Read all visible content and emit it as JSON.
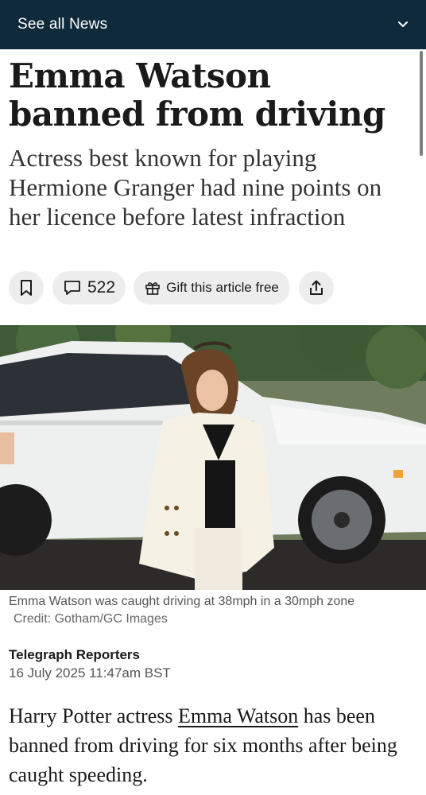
{
  "topbar": {
    "label": "See all News",
    "chevron_icon": "chevron-down-icon"
  },
  "article": {
    "headline": "Emma Watson banned from driving",
    "standfirst": "Actress best known for playing Hermione Granger had nine points on her licence before latest infraction",
    "actions": {
      "bookmark_icon": "bookmark-icon",
      "comment_count": "522",
      "gift_label": "Gift this article free",
      "share_icon": "share-icon"
    },
    "image": {
      "caption": "Emma Watson was caught driving at 38mph in a 30mph zone",
      "credit": "Credit: Gotham/GC Images"
    },
    "byline": {
      "author": "Telegraph Reporters",
      "date": "16 July 2025 11:47am BST"
    },
    "body": {
      "intro_before": "Harry Potter actress ",
      "link_text": "Emma Watson",
      "intro_after": " has been banned from driving for six months after being caught speeding."
    }
  },
  "colors": {
    "topbar_bg": "#0f2a3a",
    "pill_bg": "#ededed"
  }
}
